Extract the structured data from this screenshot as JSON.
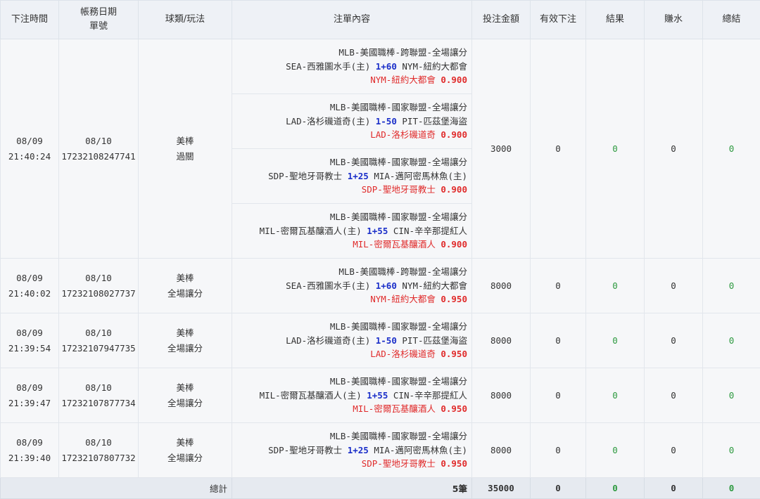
{
  "headers": {
    "time": "下注時間",
    "acct_line1": "帳務日期",
    "acct_line2": "單號",
    "type": "球類/玩法",
    "content": "注單內容",
    "amount": "投注金額",
    "effective": "有效下注",
    "result": "結果",
    "rebate": "賺水",
    "summary": "總結"
  },
  "colors": {
    "spread": "#1b2fc9",
    "pick": "#e02b2b",
    "positive": "#2e9a40",
    "header_bg": "#eef1f6",
    "footer_bg": "#e6eaf0"
  },
  "parlay": {
    "date": "08/09",
    "time": "21:40:24",
    "acct_date": "08/10",
    "ticket": "17232108247741",
    "type_line1": "美棒",
    "type_line2": "過關",
    "amount": "3000",
    "effective": "0",
    "result": "0",
    "rebate": "0",
    "summary": "0",
    "legs": [
      {
        "league": "MLB-美國職棒-跨聯盟-全場讓分",
        "home": "SEA-西雅圖水手(主)",
        "spread": "1+60",
        "away": "NYM-紐約大都會",
        "pick": "NYM-紐約大都會",
        "odds": "0.900"
      },
      {
        "league": "MLB-美國職棒-國家聯盟-全場讓分",
        "home": "LAD-洛杉磯道奇(主)",
        "spread": "1-50",
        "away": "PIT-匹茲堡海盜",
        "pick": "LAD-洛杉磯道奇",
        "odds": "0.900"
      },
      {
        "league": "MLB-美國職棒-國家聯盟-全場讓分",
        "home": "SDP-聖地牙哥教士",
        "spread": "1+25",
        "away": "MIA-邁阿密馬林魚(主)",
        "pick": "SDP-聖地牙哥教士",
        "odds": "0.900"
      },
      {
        "league": "MLB-美國職棒-國家聯盟-全場讓分",
        "home": "MIL-密爾瓦基釀酒人(主)",
        "spread": "1+55",
        "away": "CIN-辛辛那提紅人",
        "pick": "MIL-密爾瓦基釀酒人",
        "odds": "0.900"
      }
    ]
  },
  "singles": [
    {
      "date": "08/09",
      "time": "21:40:02",
      "acct_date": "08/10",
      "ticket": "17232108027737",
      "type_line1": "美棒",
      "type_line2": "全場讓分",
      "league": "MLB-美國職棒-跨聯盟-全場讓分",
      "home": "SEA-西雅圖水手(主)",
      "spread": "1+60",
      "away": "NYM-紐約大都會",
      "pick": "NYM-紐約大都會",
      "odds": "0.950",
      "amount": "8000",
      "effective": "0",
      "result": "0",
      "rebate": "0",
      "summary": "0"
    },
    {
      "date": "08/09",
      "time": "21:39:54",
      "acct_date": "08/10",
      "ticket": "17232107947735",
      "type_line1": "美棒",
      "type_line2": "全場讓分",
      "league": "MLB-美國職棒-國家聯盟-全場讓分",
      "home": "LAD-洛杉磯道奇(主)",
      "spread": "1-50",
      "away": "PIT-匹茲堡海盜",
      "pick": "LAD-洛杉磯道奇",
      "odds": "0.950",
      "amount": "8000",
      "effective": "0",
      "result": "0",
      "rebate": "0",
      "summary": "0"
    },
    {
      "date": "08/09",
      "time": "21:39:47",
      "acct_date": "08/10",
      "ticket": "17232107877734",
      "type_line1": "美棒",
      "type_line2": "全場讓分",
      "league": "MLB-美國職棒-國家聯盟-全場讓分",
      "home": "MIL-密爾瓦基釀酒人(主)",
      "spread": "1+55",
      "away": "CIN-辛辛那提紅人",
      "pick": "MIL-密爾瓦基釀酒人",
      "odds": "0.950",
      "amount": "8000",
      "effective": "0",
      "result": "0",
      "rebate": "0",
      "summary": "0"
    },
    {
      "date": "08/09",
      "time": "21:39:40",
      "acct_date": "08/10",
      "ticket": "17232107807732",
      "type_line1": "美棒",
      "type_line2": "全場讓分",
      "league": "MLB-美國職棒-國家聯盟-全場讓分",
      "home": "SDP-聖地牙哥教士",
      "spread": "1+25",
      "away": "MIA-邁阿密馬林魚(主)",
      "pick": "SDP-聖地牙哥教士",
      "odds": "0.950",
      "amount": "8000",
      "effective": "0",
      "result": "0",
      "rebate": "0",
      "summary": "0"
    }
  ],
  "footer": {
    "label": "總計",
    "count": "5筆",
    "amount": "35000",
    "effective": "0",
    "result": "0",
    "rebate": "0",
    "summary": "0"
  }
}
